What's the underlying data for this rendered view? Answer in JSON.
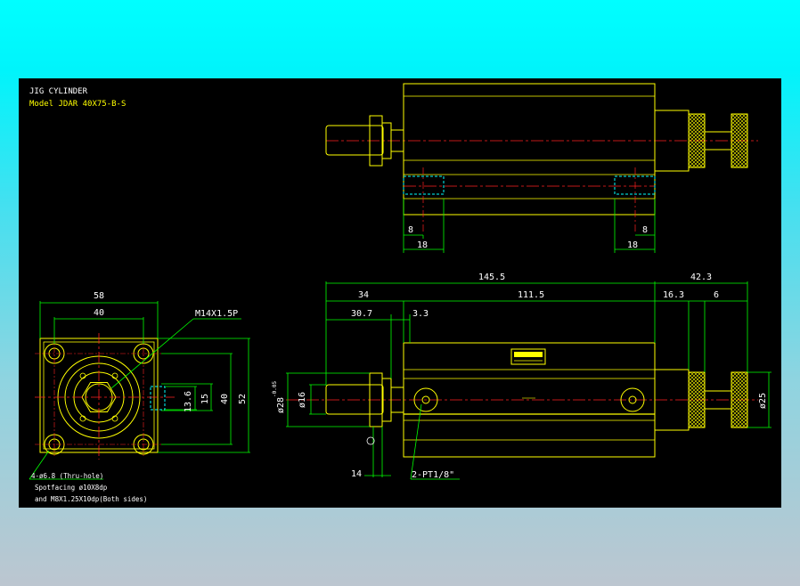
{
  "title_block": {
    "title": "JIG CYLINDER",
    "model": "Model  JDAR 40X75-B-S"
  },
  "dimensions": {
    "top_left_8": "8",
    "top_left_18": "18",
    "top_right_8": "8",
    "top_right_18": "18",
    "overall_145_5": "145.5",
    "rod_side_42_3": "42.3",
    "rod_34": "34",
    "body_111_5": "111.5",
    "dim_16_3": "16.3",
    "dim_6": "6",
    "dim_30_7": "30.7",
    "dim_3_3": "3.3",
    "bore_d28": "ø28",
    "bore_tol": "-0.05",
    "rod_d16": "ø16",
    "knob_d25": "ø25",
    "dim_14": "14",
    "port_note": "2-PT1/8\"",
    "front_58": "58",
    "front_40": "40",
    "thread_note": "M14X1.5P",
    "side_13_6": "13.6",
    "side_15": "15",
    "side_40": "40",
    "side_52": "52"
  },
  "notes": {
    "hole_note": "4-ø6.8  (Thru-hole)",
    "spotfacing_note": "Spotfacing  ø10X8dp",
    "tap_note": "and M8X1.25X10dp(Both sides)"
  },
  "colors": {
    "background_top": "#00ffff",
    "background_bottom": "#bcc6d0",
    "canvas": "#000000",
    "outline": "#ffff00",
    "dimension": "#00ff00",
    "hidden": "#00ffff",
    "center": "#ff2020",
    "text": "#ffffff"
  }
}
